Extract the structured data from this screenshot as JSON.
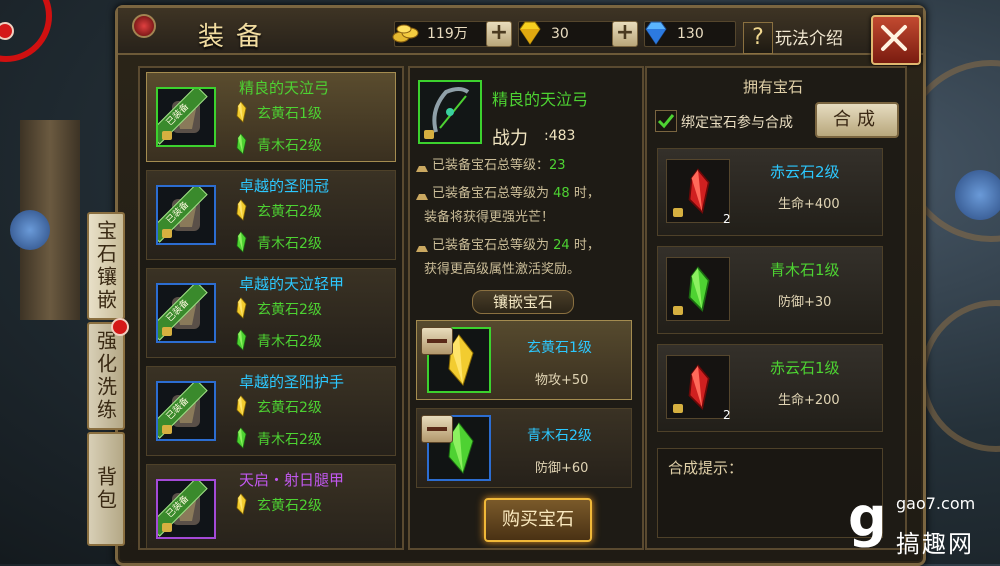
{
  "title": "装备",
  "currency": {
    "gold": {
      "value": "119万",
      "icon": "gold-ingot-icon"
    },
    "gold_diamond": {
      "value": "30",
      "icon": "yellow-diamond-icon"
    },
    "blue_diamond": {
      "value": "130",
      "icon": "blue-diamond-icon"
    }
  },
  "help": {
    "icon_text": "?",
    "label": "玩法介绍"
  },
  "side_tabs": [
    {
      "label": "宝石镶嵌"
    },
    {
      "label": "强化洗练"
    },
    {
      "label": "背包"
    }
  ],
  "equipment_list": [
    {
      "name": "精良的天泣弓",
      "quality": "green",
      "equipped_badge": "已装备",
      "gems": [
        {
          "label": "玄黄石1级",
          "color": "yellow"
        },
        {
          "label": "青木石2级",
          "color": "green"
        }
      ],
      "selected": true
    },
    {
      "name": "卓越的圣阳冠",
      "quality": "blue",
      "equipped_badge": "已装备",
      "gems": [
        {
          "label": "玄黄石2级",
          "color": "yellow"
        },
        {
          "label": "青木石2级",
          "color": "green"
        }
      ]
    },
    {
      "name": "卓越的天泣轻甲",
      "quality": "blue",
      "equipped_badge": "已装备",
      "gems": [
        {
          "label": "玄黄石2级",
          "color": "yellow"
        },
        {
          "label": "青木石2级",
          "color": "green"
        }
      ]
    },
    {
      "name": "卓越的圣阳护手",
      "quality": "blue",
      "equipped_badge": "已装备",
      "gems": [
        {
          "label": "玄黄石2级",
          "color": "yellow"
        },
        {
          "label": "青木石2级",
          "color": "green"
        }
      ]
    },
    {
      "name": "天启・射日腿甲",
      "quality": "purple",
      "equipped_badge": "已装备",
      "gems": [
        {
          "label": "玄黄石2级",
          "color": "yellow"
        }
      ]
    }
  ],
  "detail": {
    "name": "精良的天泣弓",
    "power_label": "战力",
    "power_value": ":483",
    "info": {
      "line1_prefix": "已装备宝石总等级：",
      "line1_num": "23",
      "line2_prefix": "已装备宝石总等级为",
      "line2_num": "48",
      "line2_suffix": "时，",
      "line3": "装备将获得更强光芒！",
      "line4_prefix": "已装备宝石总等级为",
      "line4_num": "24",
      "line4_suffix": "时，",
      "line5": "获得更高级属性激活奖励。"
    },
    "slots_title": "镶嵌宝石",
    "slots": [
      {
        "name": "玄黄石1级",
        "attr": "物攻+50",
        "color": "yellow"
      },
      {
        "name": "青木石2级",
        "attr": "防御+60",
        "color": "green"
      }
    ],
    "buy_label": "购买宝石"
  },
  "owned": {
    "title": "拥有宝石",
    "bind_label": "绑定宝石参与合成",
    "combine_label": "合成",
    "gems": [
      {
        "name": "赤云石2级",
        "attr": "生命+400",
        "count": "2",
        "color": "red",
        "name_color": "#2cc8ff"
      },
      {
        "name": "青木石1级",
        "attr": "防御+30",
        "count": "",
        "color": "green",
        "name_color": "#4dd232"
      },
      {
        "name": "赤云石1级",
        "attr": "生命+200",
        "count": "2",
        "color": "red",
        "name_color": "#4dd232"
      }
    ],
    "hint_label": "合成提示："
  },
  "watermark": {
    "url": "gao7.com",
    "name": "搞趣网"
  },
  "colors": {
    "green_text": "#4dd232",
    "blue_text": "#2cc8ff",
    "purple_text": "#c258f0",
    "gold_border": "#f0b838"
  }
}
